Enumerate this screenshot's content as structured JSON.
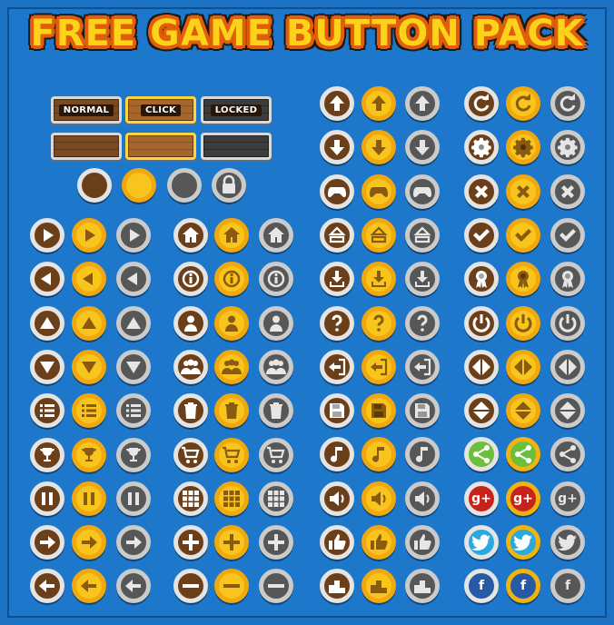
{
  "title": "FREE GAME BUTTON PACK",
  "labels": {
    "normal": "NORMAL",
    "click": "CLICK",
    "locked": "LOCKED"
  },
  "social": {
    "gplus": "g+",
    "facebook": "f"
  },
  "colors": {
    "background": "#1d78cc",
    "brown": "#6b3f19",
    "gold": "#f7c51c",
    "gray": "#575757",
    "title_fill": "#ffd21a",
    "title_outline": "#e35d0b"
  },
  "icon_sets": [
    [
      "play-right",
      "arrow-left",
      "triangle-up",
      "triangle-down",
      "list",
      "trophy",
      "pause",
      "circle-arrow-right",
      "arrow-left-bold"
    ],
    [
      "home",
      "info",
      "person",
      "people",
      "trash",
      "cart",
      "grid",
      "plus",
      "minus"
    ],
    [
      "arrow-up",
      "arrow-down",
      "gamepad",
      "eject-up",
      "download",
      "question",
      "exit",
      "save",
      "music",
      "sound",
      "thumbs-up",
      "podium"
    ],
    [
      "restart",
      "gear",
      "close",
      "check",
      "award",
      "power",
      "diamond-lr",
      "diamond-ud",
      "share",
      "gplus",
      "twitter",
      "facebook"
    ]
  ]
}
